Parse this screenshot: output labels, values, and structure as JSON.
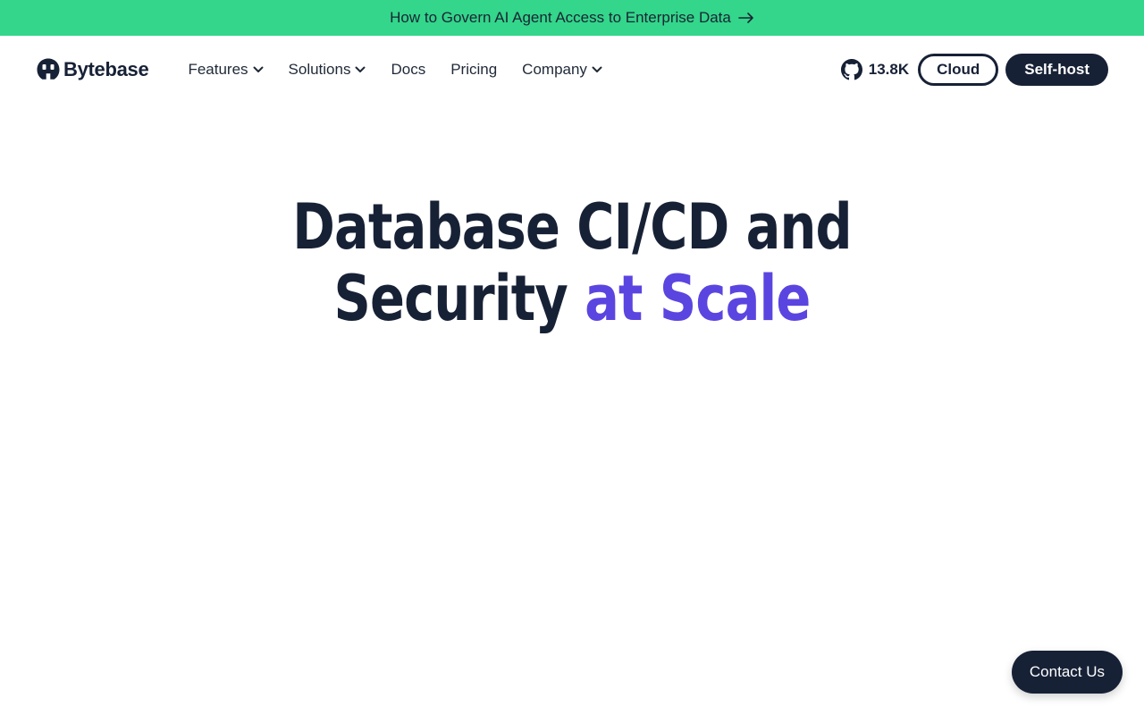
{
  "banner": {
    "text": "How to Govern AI Agent Access to Enterprise Data",
    "arrow_icon": "arrow-right-icon",
    "background": "#33d68b"
  },
  "nav": {
    "logo_text": "Bytebase",
    "items": [
      {
        "label": "Features",
        "has_dropdown": true
      },
      {
        "label": "Solutions",
        "has_dropdown": true
      },
      {
        "label": "Docs",
        "has_dropdown": false
      },
      {
        "label": "Pricing",
        "has_dropdown": false
      },
      {
        "label": "Company",
        "has_dropdown": true
      }
    ],
    "github_icon": "github-icon",
    "github_stars": "13.8K",
    "cloud_label": "Cloud",
    "selfhost_label": "Self-host"
  },
  "hero": {
    "line1": "Database CI/CD and",
    "line2_plain": "Security ",
    "line2_accent": "at Scale",
    "accent_color": "#5b45e0"
  },
  "contact": {
    "label": "Contact Us"
  },
  "colors": {
    "primary_dark": "#172136",
    "accent": "#5b45e0",
    "banner": "#33d68b"
  }
}
